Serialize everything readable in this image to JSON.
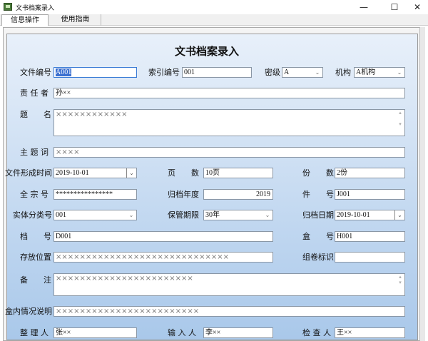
{
  "window": {
    "title": "文书档案录入",
    "minimize": "—",
    "maximize": "☐",
    "close": "✕"
  },
  "tabs": [
    {
      "label": "信息操作"
    },
    {
      "label": "使用指南"
    }
  ],
  "form": {
    "title": "文书档案录入",
    "fields": {
      "file_no": {
        "label": "文件编号",
        "value": "A001"
      },
      "index_no": {
        "label": "索引编号",
        "value": "001"
      },
      "secret": {
        "label": "密级",
        "value": "A"
      },
      "org": {
        "label": "机构",
        "value": "A机构"
      },
      "responsible": {
        "label": "责 任 者",
        "value": "孙××"
      },
      "title": {
        "label": "题　　名",
        "value": "××××××××××××"
      },
      "subject": {
        "label": "主 题 词",
        "value": "××××"
      },
      "form_date": {
        "label": "文件形成时间",
        "value": "2019-10-01"
      },
      "pages": {
        "label": "页　　数",
        "value": "10页"
      },
      "copies": {
        "label": "份　　数",
        "value": "2份"
      },
      "fonds_no": {
        "label": "全 宗 号",
        "value": "****************"
      },
      "archive_year": {
        "label": "归档年度",
        "value": "2019"
      },
      "item_no": {
        "label": "件　　号",
        "value": "J001"
      },
      "entity_class": {
        "label": "实体分类号",
        "value": "001"
      },
      "retention": {
        "label": "保管期限",
        "value": "30年"
      },
      "archive_date": {
        "label": "归档日期",
        "value": "2019-10-01"
      },
      "archive_no": {
        "label": "档　　号",
        "value": "D001"
      },
      "box_no": {
        "label": "盒　　号",
        "value": "H001"
      },
      "location": {
        "label": "存放位置",
        "value": "×××××××××××××××××××××××××××××"
      },
      "volume_id": {
        "label": "组卷标识",
        "value": ""
      },
      "remarks": {
        "label": "备　　注",
        "value": "×××××××××××××××××××××××"
      },
      "box_desc": {
        "label": "盒内情况说明",
        "value": "××××××××××××××××××××××××"
      },
      "organizer": {
        "label": "整 理 人",
        "value": "张××"
      },
      "inputter": {
        "label": "输 入 人",
        "value": "李××"
      },
      "checker": {
        "label": "检 查 人",
        "value": "王××"
      }
    }
  }
}
